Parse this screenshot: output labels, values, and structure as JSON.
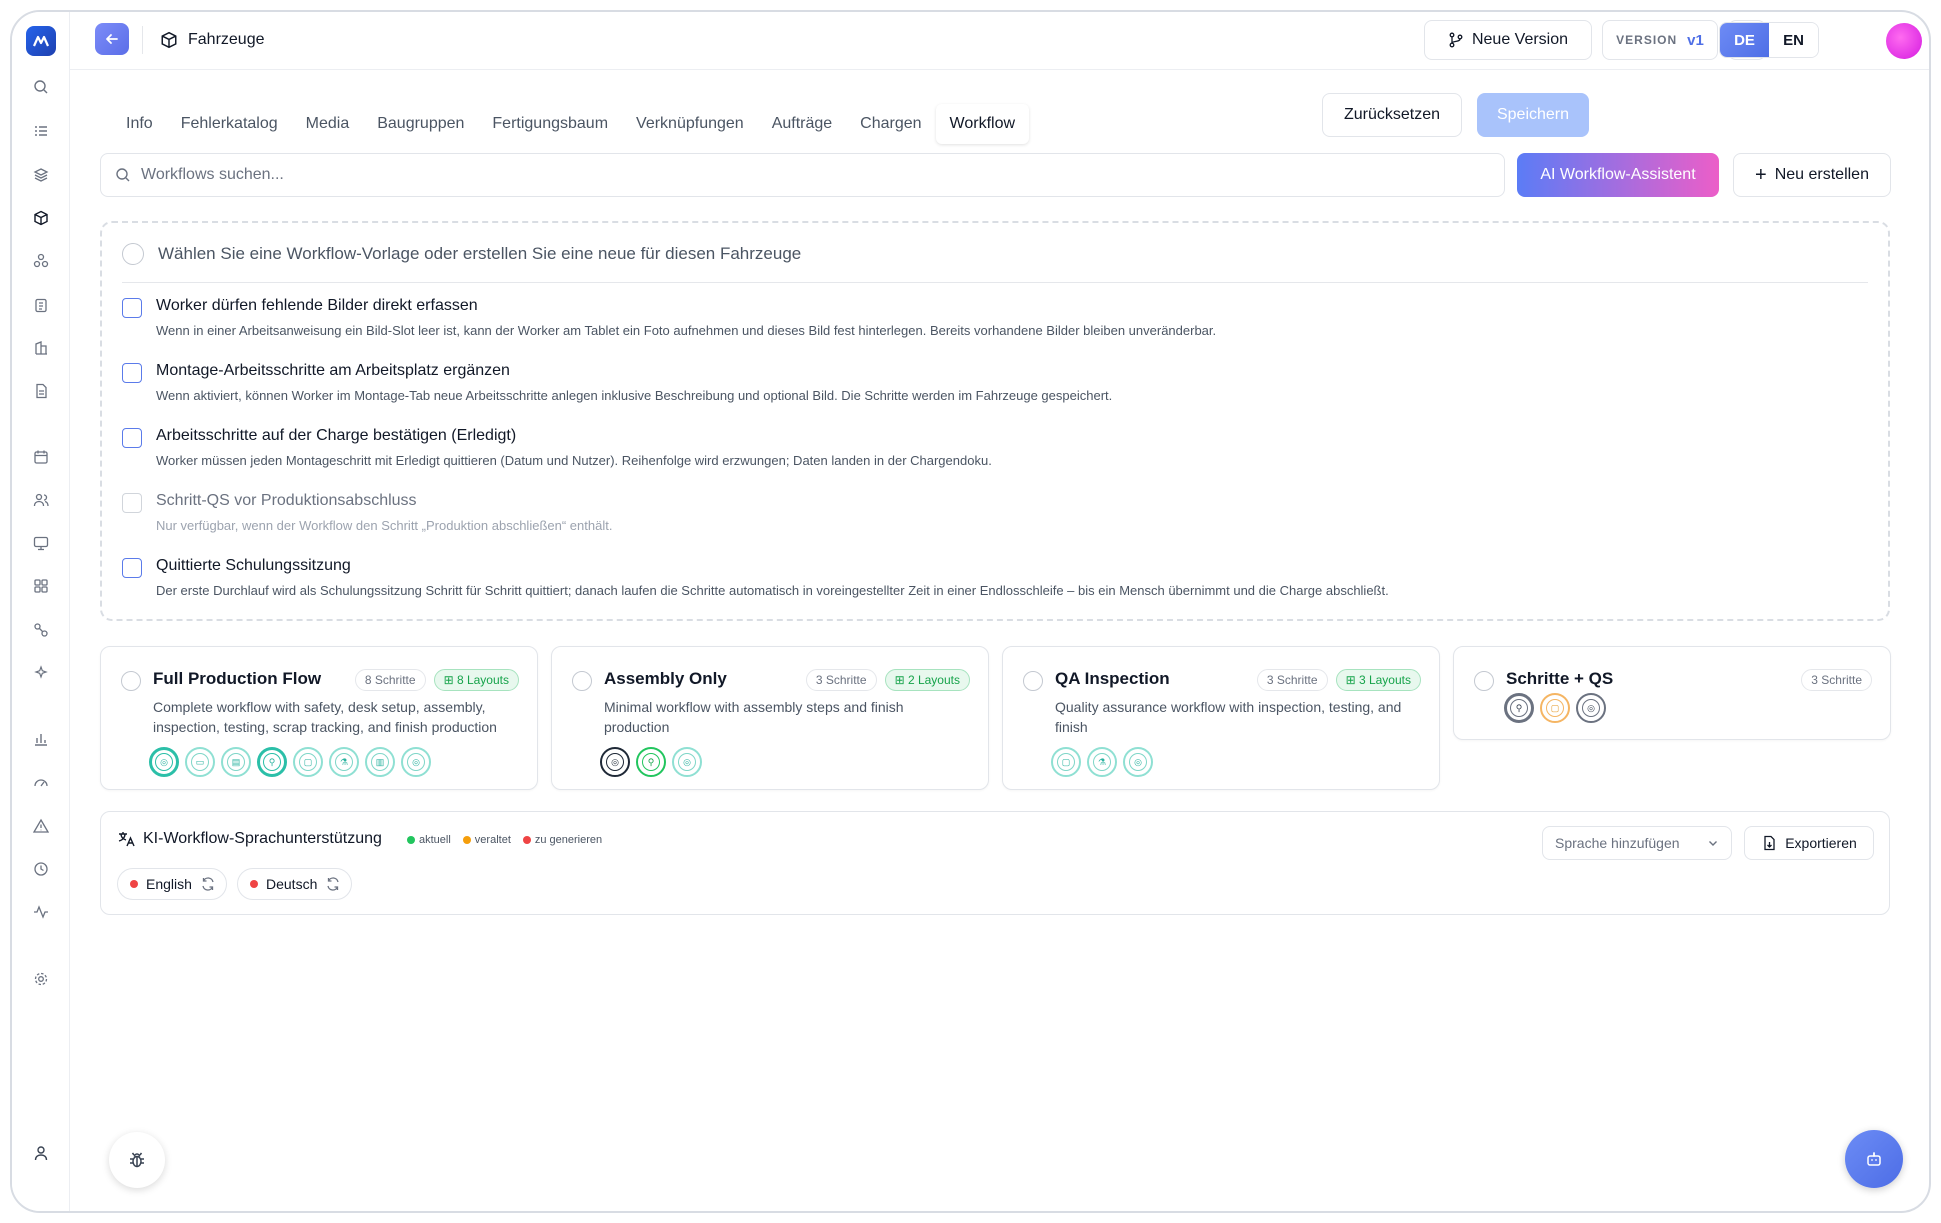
{
  "header": {
    "breadcrumb": "Fahrzeuge",
    "new_version_label": "Neue Version",
    "version_label": "VERSION",
    "version_value": "v1",
    "lang_de": "DE",
    "lang_en": "EN"
  },
  "tabs": [
    "Info",
    "Fehlerkatalog",
    "Media",
    "Baugruppen",
    "Fertigungsbaum",
    "Verknüpfungen",
    "Aufträge",
    "Chargen",
    "Workflow"
  ],
  "active_tab": "Workflow",
  "actions": {
    "reset_label": "Zurücksetzen",
    "save_label": "Speichern"
  },
  "search": {
    "placeholder": "Workflows suchen...",
    "ai_assistant_label": "AI Workflow-Assistent",
    "new_label": "Neu erstellen"
  },
  "template_prompt": "Wählen Sie eine Workflow-Vorlage oder erstellen Sie eine neue für diesen Fahrzeuge",
  "options": [
    {
      "title": "Worker dürfen fehlende Bilder direkt erfassen",
      "desc": "Wenn in einer Arbeitsanweisung ein Bild-Slot leer ist, kann der Worker am Tablet ein Foto aufnehmen und dieses Bild fest hinterlegen. Bereits vorhandene Bilder bleiben unveränderbar.",
      "enabled": true
    },
    {
      "title": "Montage-Arbeitsschritte am Arbeitsplatz ergänzen",
      "desc": "Wenn aktiviert, können Worker im Montage-Tab neue Arbeitsschritte anlegen inklusive Beschreibung und optional Bild. Die Schritte werden im Fahrzeuge gespeichert.",
      "enabled": true
    },
    {
      "title": "Arbeitsschritte auf der Charge bestätigen (Erledigt)",
      "desc": "Worker müssen jeden Montageschritt mit Erledigt quittieren (Datum und Nutzer). Reihenfolge wird erzwungen; Daten landen in der Chargendoku.",
      "enabled": true
    },
    {
      "title": "Schritt-QS vor Produktionsabschluss",
      "desc": "Nur verfügbar, wenn der Workflow den Schritt „Produktion abschließen“ enthält.",
      "enabled": false
    },
    {
      "title": "Quittierte Schulungssitzung",
      "desc": "Der erste Durchlauf wird als Schulungssitzung Schritt für Schritt quittiert; danach laufen die Schritte automatisch in voreingestellter Zeit in einer Endlosschleife – bis ein Mensch übernimmt und die Charge abschließt.",
      "enabled": true
    }
  ],
  "workflows": [
    {
      "name": "Full Production Flow",
      "steps_badge": "8 Schritte",
      "layouts_badge": "8 Layouts",
      "desc": "Complete workflow with safety, desk setup, assembly, inspection, testing, scrap tracking, and finish production"
    },
    {
      "name": "Assembly Only",
      "steps_badge": "3 Schritte",
      "layouts_badge": "2 Layouts",
      "desc": "Minimal workflow with assembly steps and finish production"
    },
    {
      "name": "QA Inspection",
      "steps_badge": "3 Schritte",
      "layouts_badge": "3 Layouts",
      "desc": "Quality assurance workflow with inspection, testing, and finish"
    },
    {
      "name": "Schritte + QS",
      "steps_badge": "3 Schritte"
    }
  ],
  "translation": {
    "title": "KI-Workflow-Sprachunterstützung",
    "legend_current": "aktuell",
    "legend_outdated": "veraltet",
    "legend_generate": "zu generieren",
    "languages": [
      "English",
      "Deutsch"
    ],
    "add_language_label": "Sprache hinzufügen",
    "export_label": "Exportieren"
  },
  "colors": {
    "accent_blue": "#4f6fe6",
    "ai_gradient_start": "#5b7cf6",
    "ai_gradient_end": "#ec5ec8",
    "status_current": "#22c55e",
    "status_outdated": "#f59e0b",
    "status_generate": "#ef4444"
  }
}
